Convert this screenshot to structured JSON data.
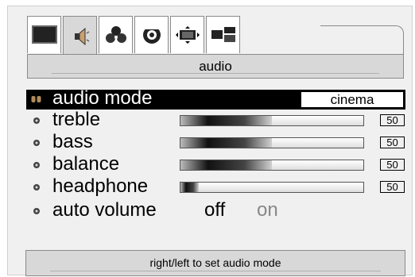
{
  "tabs": [
    {
      "icon": "picture-icon",
      "active": false
    },
    {
      "icon": "speaker-icon",
      "active": true
    },
    {
      "icon": "channels-icon",
      "active": false
    },
    {
      "icon": "setup-icon",
      "active": false
    },
    {
      "icon": "screen-format-icon",
      "active": false
    },
    {
      "icon": "pip-icon",
      "active": false
    }
  ],
  "header": {
    "title": "audio"
  },
  "menu": {
    "audio_mode": {
      "label": "audio mode",
      "value": "cinema"
    },
    "treble": {
      "label": "treble",
      "value": "50",
      "level": 50
    },
    "bass": {
      "label": "bass",
      "value": "50",
      "level": 50
    },
    "balance": {
      "label": "balance",
      "value": "50",
      "level": 50
    },
    "headphone": {
      "label": "headphone",
      "value": "50",
      "level": 10
    },
    "auto_volume": {
      "label": "auto volume",
      "option_off": "off",
      "option_on": "on",
      "selected": "off"
    }
  },
  "hint": {
    "text": "right/left to set audio mode"
  },
  "colors": {
    "highlight": "#000000",
    "panel": "#f0f0f0",
    "bar": "#d8d8d8"
  }
}
